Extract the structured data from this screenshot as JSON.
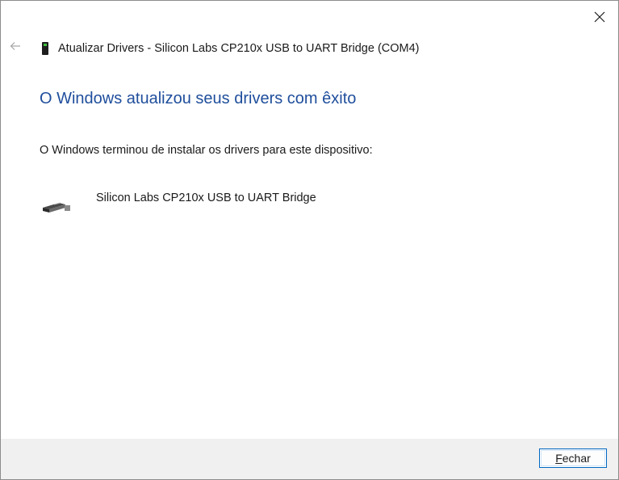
{
  "window": {
    "title": "Atualizar Drivers - Silicon Labs CP210x USB to UART Bridge (COM4)",
    "title_icon": "usb-device-icon",
    "close_icon": "close-icon",
    "back_icon": "back-arrow-icon"
  },
  "content": {
    "heading": "O Windows atualizou seus drivers com êxito",
    "description": "O Windows terminou de instalar os drivers para este dispositivo:",
    "device": {
      "icon": "serial-connector-icon",
      "name": "Silicon Labs CP210x USB to UART Bridge"
    }
  },
  "footer": {
    "close_button_accel": "F",
    "close_button_rest": "echar"
  },
  "colors": {
    "heading": "#1f4e9c",
    "footer_bg": "#f0f0f0",
    "button_border": "#0067c0"
  }
}
